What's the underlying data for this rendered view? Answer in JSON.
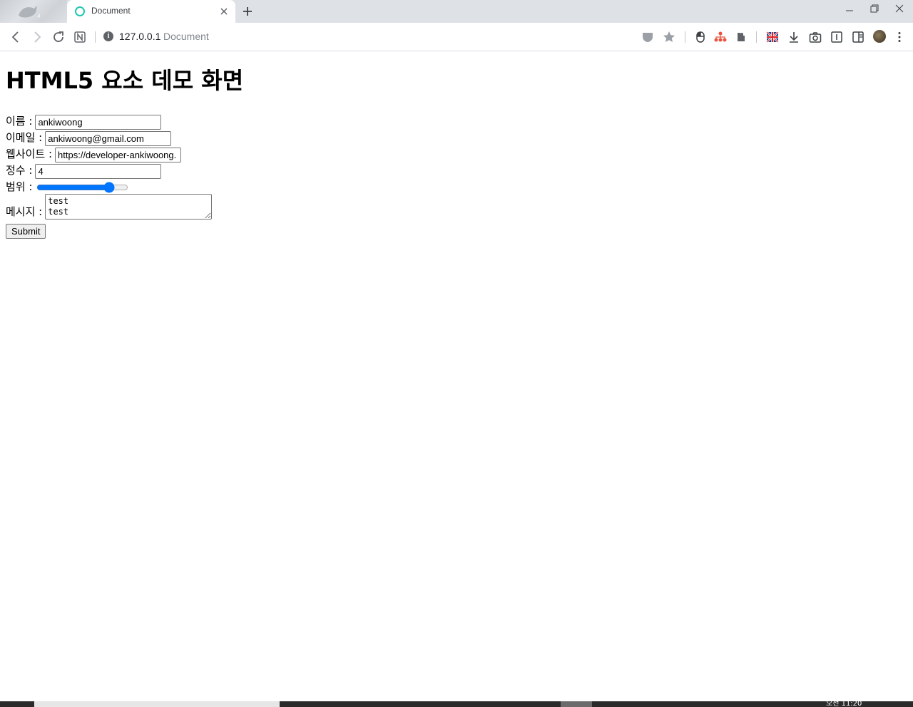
{
  "browser": {
    "tab": {
      "title": "Document"
    },
    "address": {
      "host": "127.0.0.1",
      "page_title": "Document"
    }
  },
  "page": {
    "heading": "HTML5 요소 데모 화면",
    "form": {
      "name_label": "이름 :",
      "name_value": "ankiwoong",
      "email_label": "이메일 :",
      "email_value": "ankiwoong@gmail.com",
      "website_label": "웹사이트 :",
      "website_value": "https://developer-ankiwoong.",
      "integer_label": "정수 :",
      "integer_value": "4",
      "range_label": "범위 :",
      "range_value": 83,
      "message_label": "메시지 :",
      "message_value": "test\ntest",
      "submit_label": "Submit"
    }
  },
  "taskbar": {
    "clock": "오전 11:20"
  },
  "colors": {
    "accent": "#0075ff",
    "favicon": "#1fc7b0",
    "toolbar_icon": "#5f6368"
  }
}
